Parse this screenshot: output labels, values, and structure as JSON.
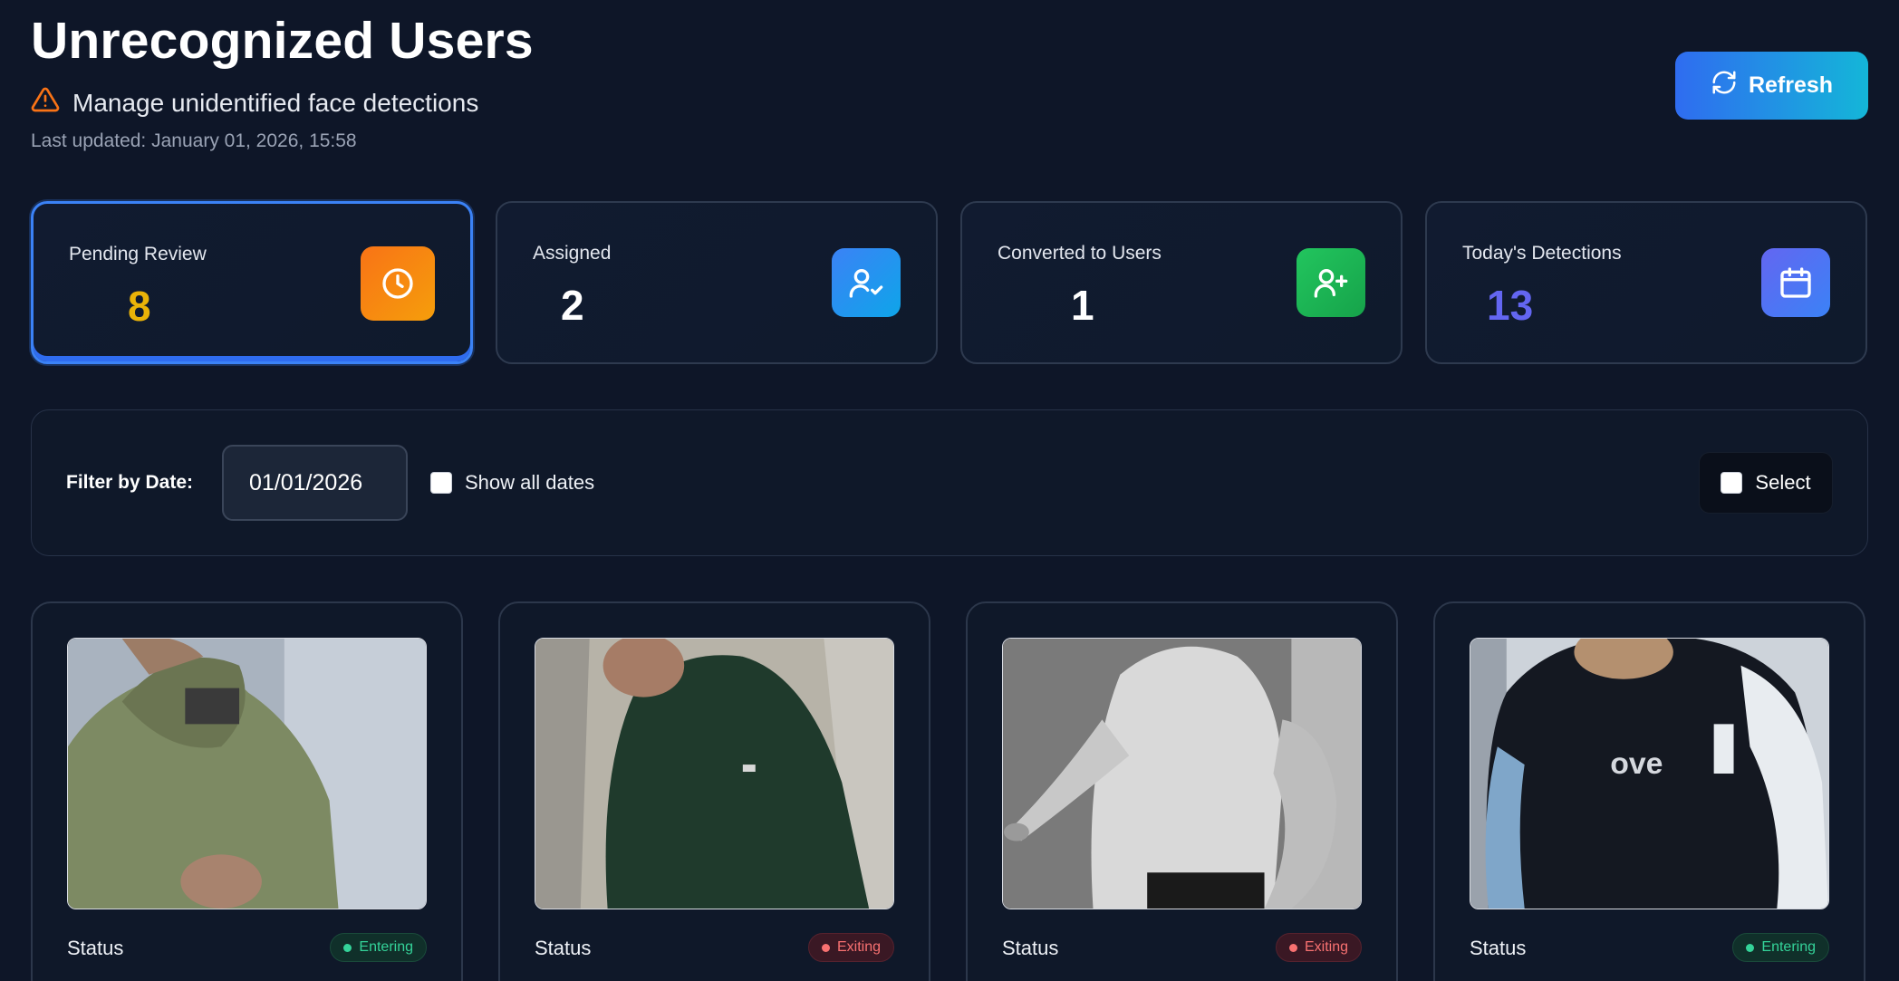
{
  "header": {
    "title": "Unrecognized Users",
    "subtitle": "Manage unidentified face detections",
    "last_updated": "Last updated: January 01, 2026, 15:58",
    "refresh_label": "Refresh"
  },
  "stats": [
    {
      "label": "Pending Review",
      "value": "8",
      "value_color": "#eab308",
      "icon": "clock-icon",
      "icon_bg": "#f59e0b",
      "active": true
    },
    {
      "label": "Assigned",
      "value": "2",
      "value_color": "#ffffff",
      "icon": "user-check-icon",
      "icon_bg": "#3b82f6",
      "active": false
    },
    {
      "label": "Converted to Users",
      "value": "1",
      "value_color": "#ffffff",
      "icon": "user-plus-icon",
      "icon_bg": "#22c55e",
      "active": false
    },
    {
      "label": "Today's Detections",
      "value": "13",
      "value_color": "#6366f1",
      "icon": "calendar-icon",
      "icon_bg": "#6366f1",
      "active": false
    }
  ],
  "filter": {
    "label": "Filter by Date:",
    "date_value": "01/01/2026",
    "show_all_label": "Show all dates",
    "select_label": "Select"
  },
  "detections": [
    {
      "status_label": "Status",
      "badge": "Entering",
      "type": "enter"
    },
    {
      "status_label": "Status",
      "badge": "Exiting",
      "type": "exit"
    },
    {
      "status_label": "Status",
      "badge": "Exiting",
      "type": "exit"
    },
    {
      "status_label": "Status",
      "badge": "Entering",
      "type": "enter"
    }
  ],
  "colors": {
    "background": "#0e1628",
    "accent": "#3b82f6",
    "entering": "#34d399",
    "exiting": "#f87171"
  }
}
